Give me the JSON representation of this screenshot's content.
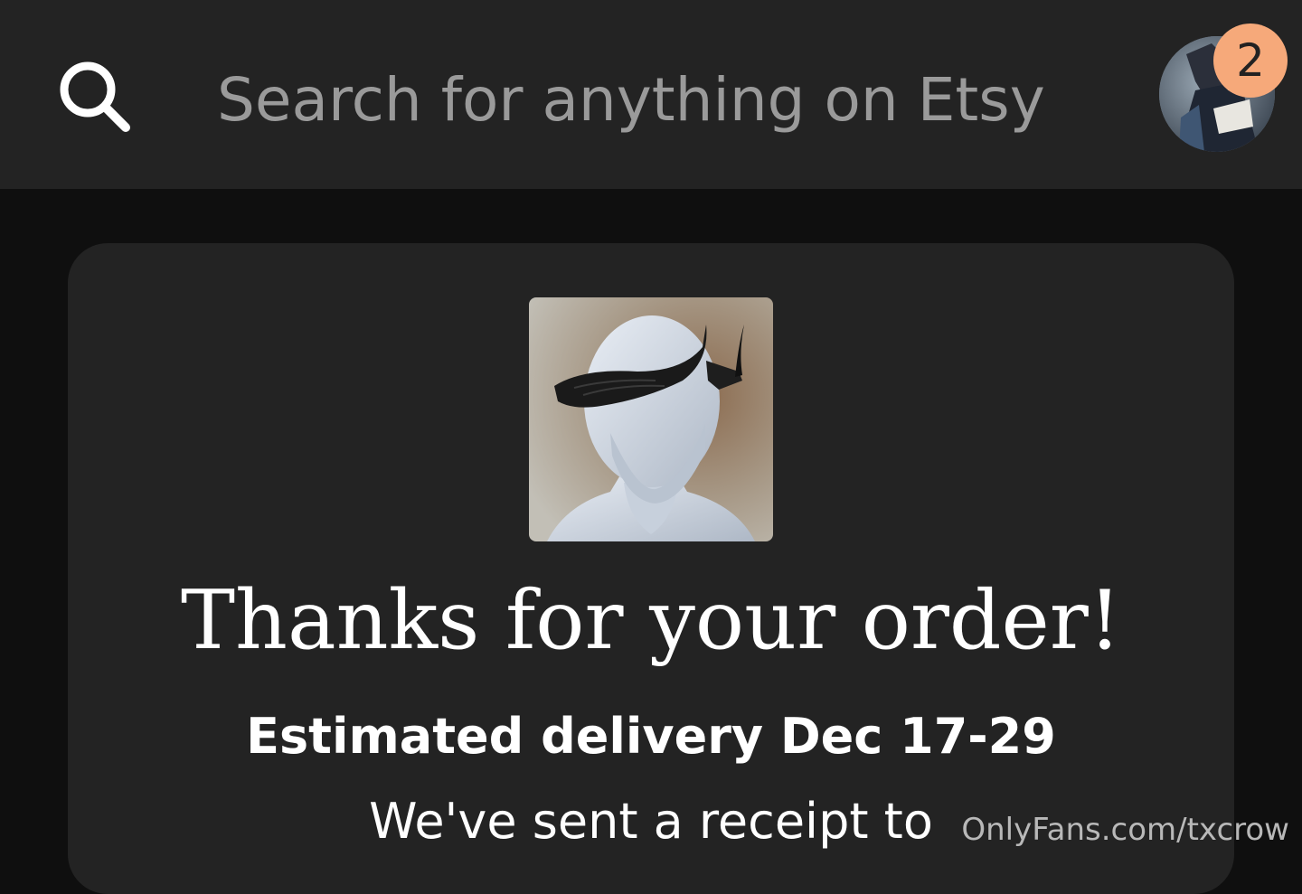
{
  "header": {
    "search_placeholder": "Search for anything on Etsy",
    "notification_count": "2"
  },
  "order": {
    "title": "Thanks for your order!",
    "delivery": "Estimated delivery Dec 17-29",
    "receipt": "We've sent a receipt to"
  },
  "watermark": "OnlyFans.com/txcrow",
  "colors": {
    "topbar": "#232323",
    "page": "#0f0f0f",
    "card": "#232323",
    "badge": "#f6a97a"
  }
}
